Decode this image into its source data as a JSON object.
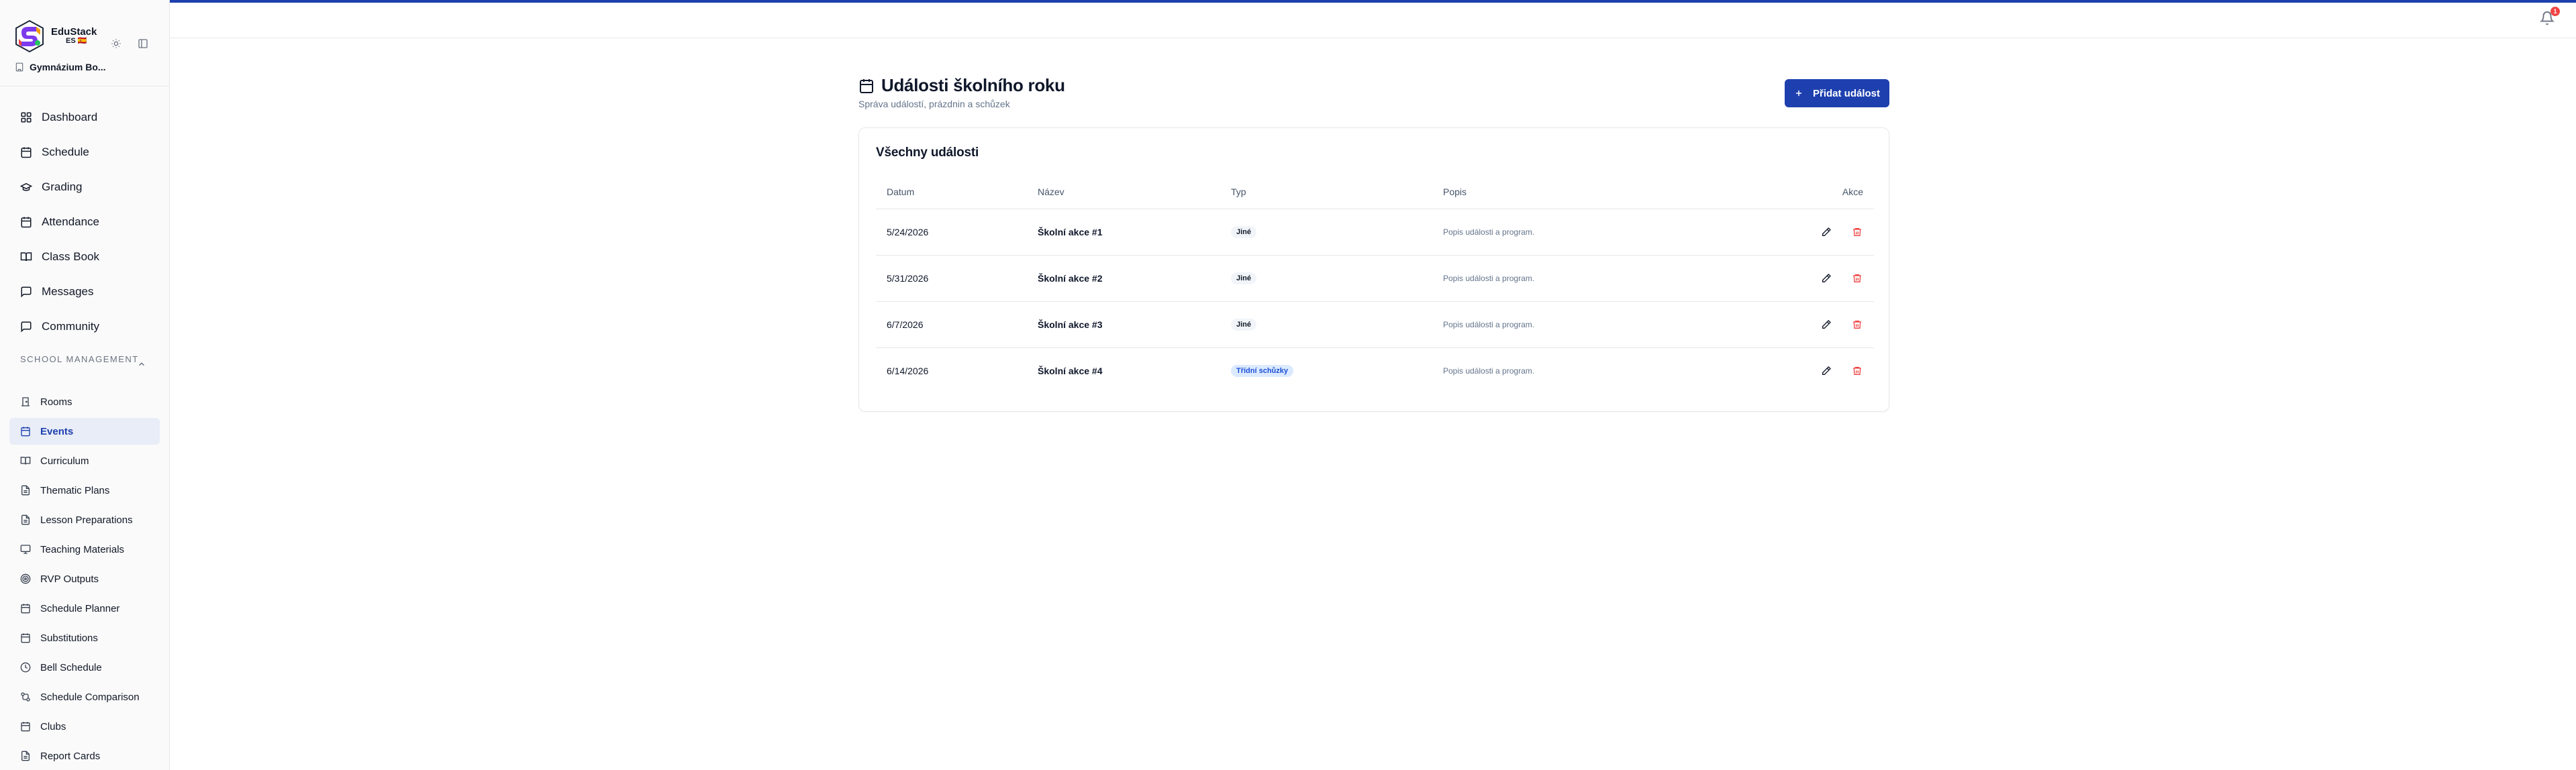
{
  "brand": {
    "name": "EduStack",
    "sub": "ES 🇪🇸",
    "school": "Gymnázium Bo..."
  },
  "nav": [
    {
      "label": "Dashboard",
      "icon": "dashboard-icon"
    },
    {
      "label": "Schedule",
      "icon": "calendar-icon"
    },
    {
      "label": "Grading",
      "icon": "grading-icon"
    },
    {
      "label": "Attendance",
      "icon": "calendar-icon"
    },
    {
      "label": "Class Book",
      "icon": "book-icon"
    },
    {
      "label": "Messages",
      "icon": "message-icon"
    },
    {
      "label": "Community",
      "icon": "message-icon"
    }
  ],
  "section": {
    "label": "SCHOOL MANAGEMENT"
  },
  "sub_nav": [
    {
      "label": "Rooms",
      "icon": "door-icon"
    },
    {
      "label": "Events",
      "icon": "calendar-icon",
      "active": true
    },
    {
      "label": "Curriculum",
      "icon": "book-icon"
    },
    {
      "label": "Thematic Plans",
      "icon": "file-icon"
    },
    {
      "label": "Lesson Preparations",
      "icon": "file-icon"
    },
    {
      "label": "Teaching Materials",
      "icon": "monitor-icon"
    },
    {
      "label": "RVP Outputs",
      "icon": "target-icon"
    },
    {
      "label": "Schedule Planner",
      "icon": "calendar-icon"
    },
    {
      "label": "Substitutions",
      "icon": "calendar-icon"
    },
    {
      "label": "Bell Schedule",
      "icon": "clock-icon"
    },
    {
      "label": "Schedule Comparison",
      "icon": "compare-icon"
    },
    {
      "label": "Clubs",
      "icon": "calendar-icon"
    },
    {
      "label": "Report Cards",
      "icon": "file-icon"
    }
  ],
  "topbar": {
    "notifications": "1"
  },
  "page": {
    "title": "Události školního roku",
    "subtitle": "Správa událostí, prázdnin a schůzek",
    "add_button": "Přidat událost"
  },
  "card": {
    "title": "Všechny události",
    "columns": [
      "Datum",
      "Název",
      "Typ",
      "Popis",
      "Akce"
    ],
    "rows": [
      {
        "date": "5/24/2026",
        "name": "Školní akce #1",
        "type": "Jiné",
        "type_style": "gray",
        "desc": "Popis události a program."
      },
      {
        "date": "5/31/2026",
        "name": "Školní akce #2",
        "type": "Jiné",
        "type_style": "gray",
        "desc": "Popis události a program."
      },
      {
        "date": "6/7/2026",
        "name": "Školní akce #3",
        "type": "Jiné",
        "type_style": "gray",
        "desc": "Popis události a program."
      },
      {
        "date": "6/14/2026",
        "name": "Školní akce #4",
        "type": "Třídní schůzky",
        "type_style": "blue",
        "desc": "Popis události a program."
      }
    ]
  },
  "colors": {
    "accent": "#1e40af",
    "danger": "#ef4444",
    "active_bg": "#e8edf7"
  }
}
